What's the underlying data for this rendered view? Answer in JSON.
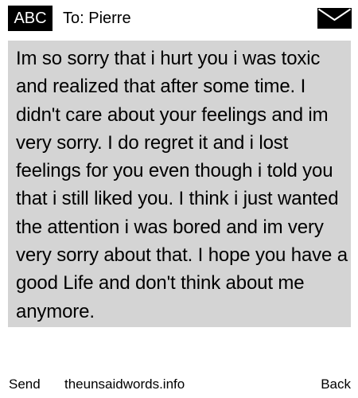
{
  "header": {
    "input_mode": "ABC",
    "recipient": "To: Pierre",
    "envelope_icon": "envelope-icon"
  },
  "message": {
    "body": "Im so sorry that i hurt you i was toxic and realized that after some time. I didn't care about your feelings and im very sorry. I do regret it and i lost feelings for you even though i told you that i still liked you. I think i just wanted the attention i was bored and im very very sorry about that. I hope you have a good Life and don't think about me anymore.",
    "highlight_color": "#d4d4d4"
  },
  "footer": {
    "send_label": "Send",
    "site": "theunsaidwords.info",
    "back_label": "Back"
  }
}
